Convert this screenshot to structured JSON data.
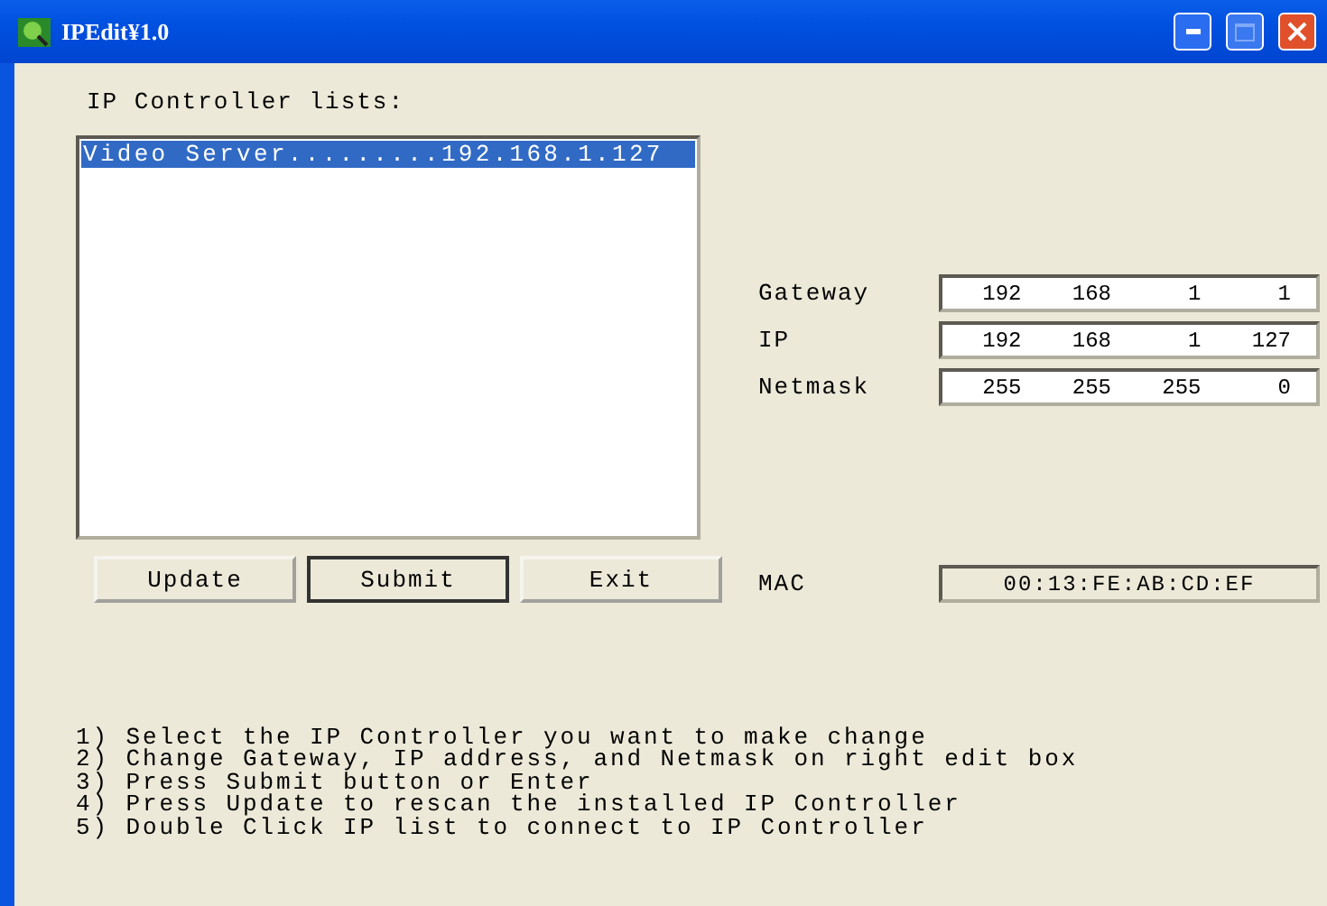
{
  "window": {
    "title": "IPEdit¥1.0"
  },
  "list": {
    "label": "IP Controller lists:",
    "items": [
      {
        "text": "Video Server.........192.168.1.127",
        "selected": true
      }
    ]
  },
  "fields": [
    {
      "label": "Gateway",
      "octets": [
        "192",
        "168",
        "1",
        "1"
      ]
    },
    {
      "label": "IP",
      "octets": [
        "192",
        "168",
        "1",
        "127"
      ]
    },
    {
      "label": "Netmask",
      "octets": [
        "255",
        "255",
        "255",
        "0"
      ]
    }
  ],
  "mac": {
    "label": "MAC",
    "value": "00:13:FE:AB:CD:EF"
  },
  "buttons": [
    {
      "label": "Update",
      "default": false
    },
    {
      "label": "Submit",
      "default": true
    },
    {
      "label": "Exit",
      "default": false
    }
  ],
  "instructions": [
    "1) Select the IP Controller you want to make change",
    "2) Change Gateway, IP address, and Netmask on right edit box",
    "3) Press Submit button or Enter",
    "4) Press Update to rescan the installed IP Controller",
    "5) Double Click IP list to connect to IP Controller"
  ]
}
